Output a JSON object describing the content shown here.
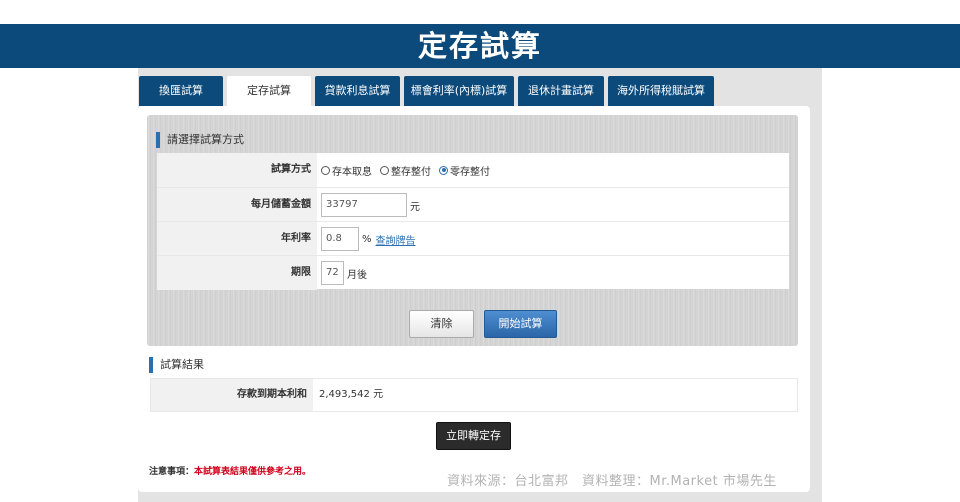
{
  "banner": {
    "title": "定存試算"
  },
  "tabs": [
    {
      "label": "換匯試算"
    },
    {
      "label": "定存試算"
    },
    {
      "label": "貸款利息試算"
    },
    {
      "label": "標會利率(內標)試算"
    },
    {
      "label": "退休計畫試算"
    },
    {
      "label": "海外所得稅賦試算"
    }
  ],
  "form": {
    "section_title": "請選擇試算方式",
    "method_label": "試算方式",
    "methods": [
      {
        "label": "存本取息",
        "selected": false
      },
      {
        "label": "整存整付",
        "selected": false
      },
      {
        "label": "零存整付",
        "selected": true
      }
    ],
    "monthly_label": "每月儲蓄金額",
    "monthly_value": "33797",
    "monthly_unit": "元",
    "rate_label": "年利率",
    "rate_value": "0.8",
    "rate_unit": "%",
    "rate_link": "查詢牌告",
    "period_label": "期限",
    "period_value": "72",
    "period_unit": "月後",
    "clear_label": "清除",
    "start_label": "開始試算"
  },
  "result": {
    "section_title": "試算結果",
    "label": "存款到期本利和",
    "value": "2,493,542 元",
    "transfer_label": "立即轉定存"
  },
  "note": {
    "prefix": "注意事項：",
    "text": "本試算表結果僅供參考之用。"
  },
  "source": "資料來源：台北富邦　資料整理：Mr.Market 市場先生",
  "colors": {
    "brand": "#0b4a7a",
    "accent": "#2a6fb0",
    "warning": "#d0021b"
  }
}
